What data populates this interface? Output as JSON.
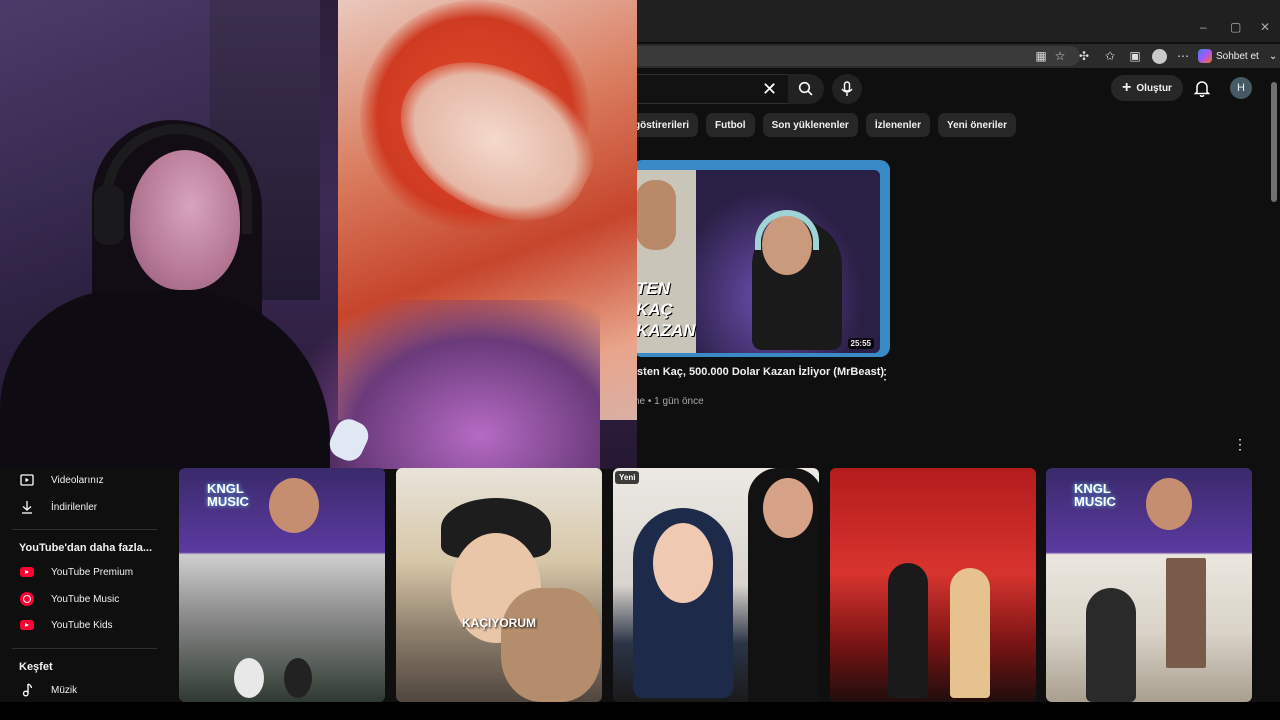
{
  "browser": {
    "chat_label": "Sohbet et",
    "window_controls": [
      "–",
      "▢",
      "✕"
    ]
  },
  "header": {
    "create_label": "Oluştur",
    "avatar_initial": "H"
  },
  "chips": [
    "göstirerileri",
    "Futbol",
    "Son yüklenenler",
    "İzlenenler",
    "Yeni öneriler"
  ],
  "featured": {
    "thumbnail_text": "TEN KAÇ KAZAN",
    "duration": "25:55",
    "title": "isten Kaç, 500.000 Dolar Kazan İzliyor (MrBeast)",
    "meta": "ne • 1 gün önce"
  },
  "sidebar": {
    "items_top": [
      {
        "label": "Videolarınız",
        "icon": "play-square-icon"
      },
      {
        "label": "İndirilenler",
        "icon": "download-icon"
      }
    ],
    "more_heading": "YouTube'dan daha fazla...",
    "more_items": [
      {
        "label": "YouTube Premium",
        "icon": "youtube-premium-icon"
      },
      {
        "label": "YouTube Music",
        "icon": "youtube-music-icon"
      },
      {
        "label": "YouTube Kids",
        "icon": "youtube-kids-icon"
      }
    ],
    "explore_heading": "Keşfet",
    "explore_items": [
      {
        "label": "Müzik",
        "icon": "music-note-icon"
      }
    ]
  },
  "shorts": [
    {
      "overlay": "KNGL MUSIC"
    },
    {
      "overlay": "KAÇIYORUM"
    },
    {
      "badge": "Yeni"
    },
    {
      "overlay": ""
    },
    {
      "overlay": "KNGL MUSIC"
    }
  ],
  "colors": {
    "accent_red": "#ff0033",
    "background": "#0f0f0f",
    "chip_bg": "#272727",
    "featured_border": "#3a8ac7"
  }
}
